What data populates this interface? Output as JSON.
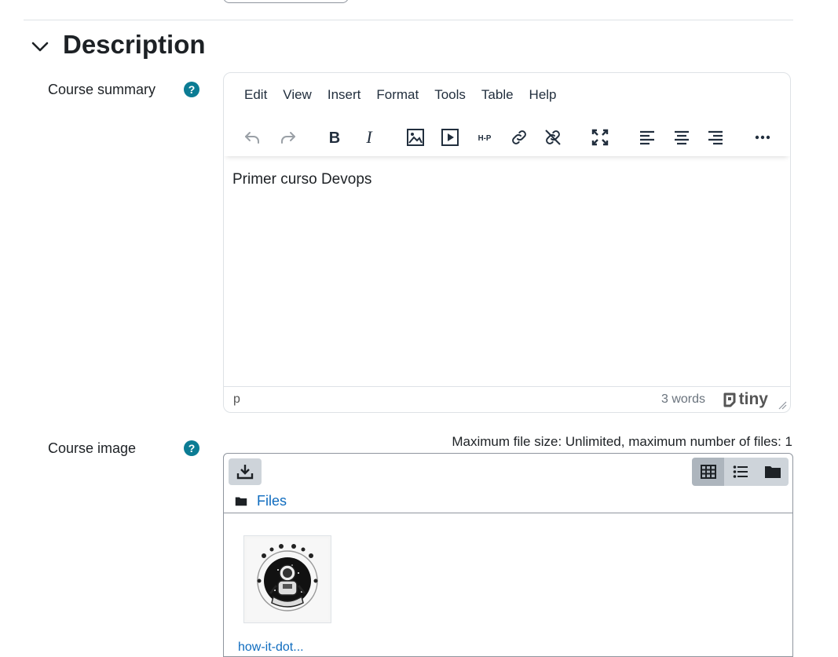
{
  "section": {
    "title": "Description"
  },
  "course_summary": {
    "label": "Course summary",
    "help": "?",
    "menu": [
      "Edit",
      "View",
      "Insert",
      "Format",
      "Tools",
      "Table",
      "Help"
    ],
    "content": "Primer curso Devops",
    "path": "p",
    "word_count": "3 words",
    "brand": "tiny",
    "toolbar": [
      "undo-icon",
      "redo-icon",
      "bold-icon",
      "italic-icon",
      "image-icon",
      "media-icon",
      "h5p-icon",
      "link-icon",
      "unlink-icon",
      "fullscreen-icon",
      "align-left-icon",
      "align-center-icon",
      "align-right-icon",
      "more-icon"
    ]
  },
  "course_image": {
    "label": "Course image",
    "help": "?",
    "max_info": "Maximum file size: Unlimited, maximum number of files: 1",
    "breadcrumb": "Files",
    "file_name": "how-it-dot..."
  },
  "colors": {
    "link": "#0f6cbf",
    "help_badge": "#0b7c94",
    "toolbar_btn": "#ced4da"
  }
}
